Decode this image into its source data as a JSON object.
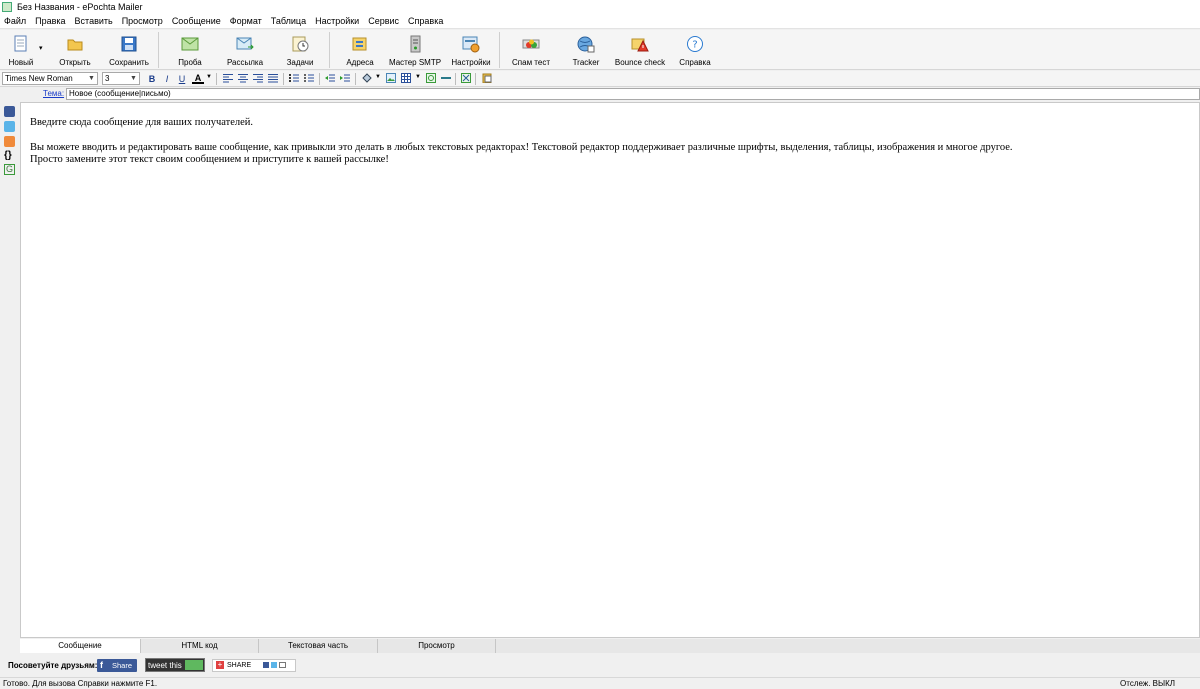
{
  "window": {
    "title": "Без Названия - ePochta Mailer"
  },
  "menu": [
    "Файл",
    "Правка",
    "Вставить",
    "Просмотр",
    "Сообщение",
    "Формат",
    "Таблица",
    "Настройки",
    "Сервис",
    "Справка"
  ],
  "toolbar": {
    "new": "Новый",
    "open": "Открыть",
    "save": "Сохранить",
    "test": "Проба",
    "send": "Рассылка",
    "tasks": "Задачи",
    "addresses": "Адреса",
    "smtp_wizard": "Мастер SMTP",
    "settings": "Настройки",
    "spam_test": "Спам тест",
    "tracker": "Tracker",
    "bounce_check": "Bounce check",
    "help": "Справка"
  },
  "format": {
    "font_family": "Times New Roman",
    "font_size": "3",
    "bold": "B",
    "italic": "I",
    "underline": "U",
    "font_color": "A"
  },
  "subject": {
    "label": "Тема:",
    "value": "Новое (сообщение|письмо)"
  },
  "editor": {
    "line1": "Введите сюда сообщение для ваших получателей.",
    "line2": "Вы можете вводить и редактировать ваше сообщение, как привыкли это делать в любых текстовых редакторах! Текстовой редактор поддерживает различные шрифты, выделения, таблицы, изображения и многое другое.",
    "line3": "Просто замените этот текст своим сообщением и приступите к вашей рассылке!"
  },
  "tabs": [
    "Сообщение",
    "HTML код",
    "Текстовая часть",
    "Просмотр"
  ],
  "share": {
    "label": "Посоветуйте друзьям:",
    "facebook": "Share",
    "tweet": "tweet this",
    "addthis": "SHARE"
  },
  "status": {
    "left": "Готово. Для вызова Справки нажмите F1.",
    "right": "Отслеж. ВЫКЛ"
  },
  "colors": {
    "accent": "#3b5998",
    "link": "#1a3cc8"
  }
}
